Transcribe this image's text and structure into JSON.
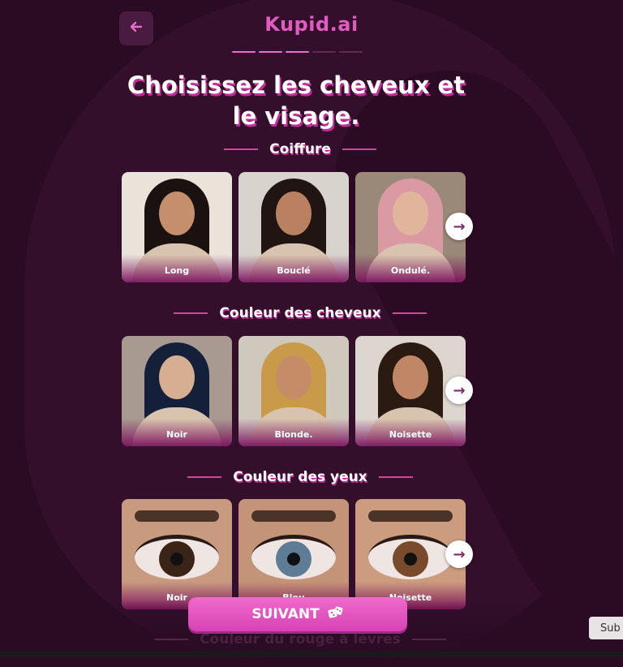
{
  "app": {
    "brand": "Kupid.ai",
    "back_icon": "arrow-left-icon"
  },
  "progress": {
    "total_steps": 5,
    "completed_steps": 3
  },
  "title": "Choisissez les cheveux et le visage.",
  "sections": [
    {
      "title": "Coiffure",
      "options": [
        {
          "label": "Long",
          "hair_color": "#1a1210",
          "skin": "#c58e6c",
          "bg": "#e9e3da"
        },
        {
          "label": "Bouclé",
          "hair_color": "#201512",
          "skin": "#b98162",
          "bg": "#d8d3cc"
        },
        {
          "label": "Ondulé.",
          "hair_color": "#d99aa3",
          "skin": "#e0b59c",
          "bg": "#9a8878"
        }
      ]
    },
    {
      "title": "Couleur des cheveux",
      "options": [
        {
          "label": "Noir",
          "hair_color": "#14203a",
          "skin": "#d6ae92",
          "bg": "#a89a90"
        },
        {
          "label": "Blonde.",
          "hair_color": "#c99a4a",
          "skin": "#c48d68",
          "bg": "#cfc8bd"
        },
        {
          "label": "Noisette",
          "hair_color": "#2a1a12",
          "skin": "#bf8766",
          "bg": "#dcd6cf"
        }
      ]
    },
    {
      "title": "Couleur des yeux",
      "options": [
        {
          "label": "Noir",
          "iris_color": "#3a2418",
          "skin": "#c89a80"
        },
        {
          "label": "Bleu",
          "iris_color": "#5f7c96",
          "skin": "#c49478"
        },
        {
          "label": "Noisette",
          "iris_color": "#7a4a2c",
          "skin": "#cc9c7e"
        }
      ]
    }
  ],
  "next_section_title": "Couleur du rouge à lèvres",
  "cta": {
    "label": "SUIVANT",
    "icon": "dice-icon"
  },
  "side_button": {
    "label": "Sub"
  },
  "colors": {
    "accent": "#e05cc0",
    "background": "#2a0b24"
  }
}
